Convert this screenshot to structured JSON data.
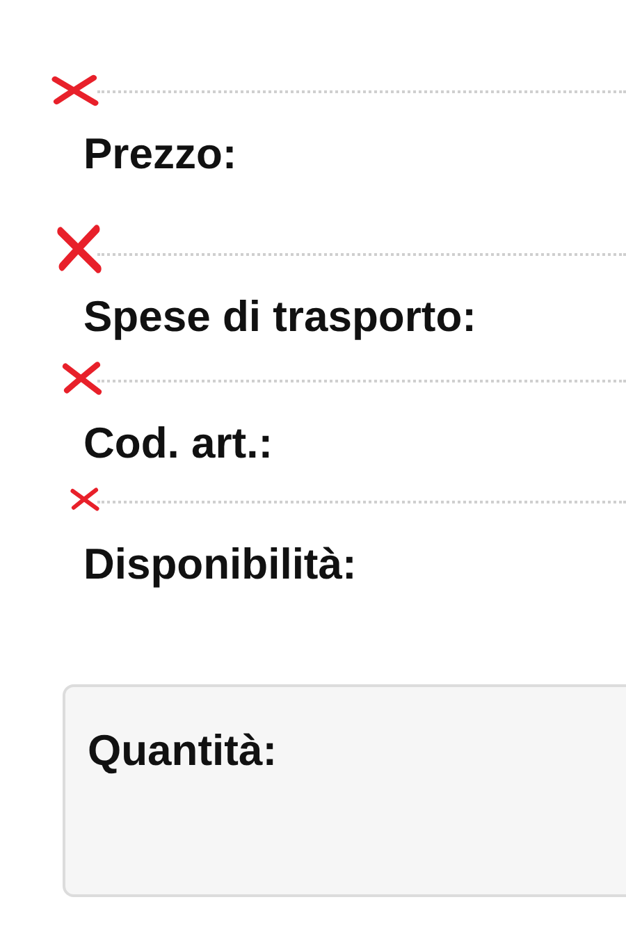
{
  "details": [
    {
      "label": "Prezzo:",
      "crossed": true
    },
    {
      "label": "Spese di trasporto:",
      "crossed": true
    },
    {
      "label": "Cod. art.:",
      "crossed": true
    },
    {
      "label": "Disponibilità:",
      "crossed": true
    }
  ],
  "quantity_panel": {
    "label": "Quantità:"
  }
}
